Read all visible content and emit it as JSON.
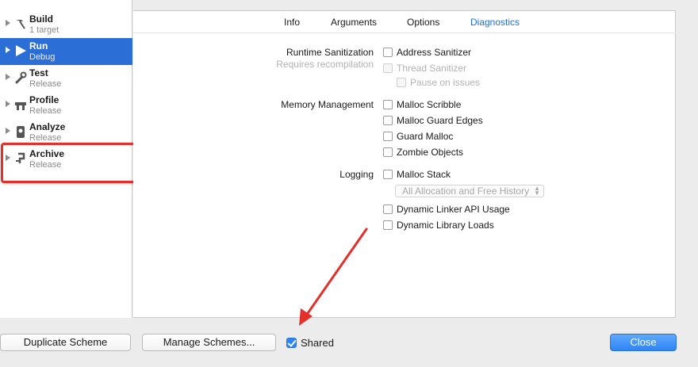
{
  "sidebar": {
    "items": [
      {
        "name": "Build",
        "sub": "1 target",
        "icon": "hammer-icon"
      },
      {
        "name": "Run",
        "sub": "Debug",
        "icon": "play-icon",
        "selected": true
      },
      {
        "name": "Test",
        "sub": "Release",
        "icon": "wrench-icon"
      },
      {
        "name": "Profile",
        "sub": "Release",
        "icon": "gauge-icon"
      },
      {
        "name": "Analyze",
        "sub": "Release",
        "icon": "analyze-icon"
      },
      {
        "name": "Archive",
        "sub": "Release",
        "icon": "archive-icon"
      }
    ]
  },
  "tabs": [
    "Info",
    "Arguments",
    "Options",
    "Diagnostics"
  ],
  "active_tab": "Diagnostics",
  "diagnostics": {
    "runtime_sanitization": {
      "label": "Runtime Sanitization",
      "sublabel": "Requires recompilation",
      "options": [
        {
          "label": "Address Sanitizer",
          "checked": false
        },
        {
          "label": "Thread Sanitizer",
          "checked": false,
          "disabled": true
        },
        {
          "label": "Pause on issues",
          "checked": false,
          "disabled": true
        }
      ]
    },
    "memory_management": {
      "label": "Memory Management",
      "options": [
        {
          "label": "Malloc Scribble",
          "checked": false
        },
        {
          "label": "Malloc Guard Edges",
          "checked": false
        },
        {
          "label": "Guard Malloc",
          "checked": false
        },
        {
          "label": "Zombie Objects",
          "checked": false
        }
      ]
    },
    "logging": {
      "label": "Logging",
      "options": [
        {
          "label": "Malloc Stack",
          "checked": false
        },
        {
          "label": "Dynamic Linker API Usage",
          "checked": false
        },
        {
          "label": "Dynamic Library Loads",
          "checked": false
        }
      ],
      "malloc_stack_select": "All Allocation and Free History"
    }
  },
  "footer": {
    "duplicate": "Duplicate Scheme",
    "manage": "Manage Schemes...",
    "shared": "Shared",
    "shared_checked": true,
    "close": "Close"
  },
  "colors": {
    "accent": "#2f84f5",
    "selection": "#2b6fd6",
    "annotation": "#e3302b"
  }
}
